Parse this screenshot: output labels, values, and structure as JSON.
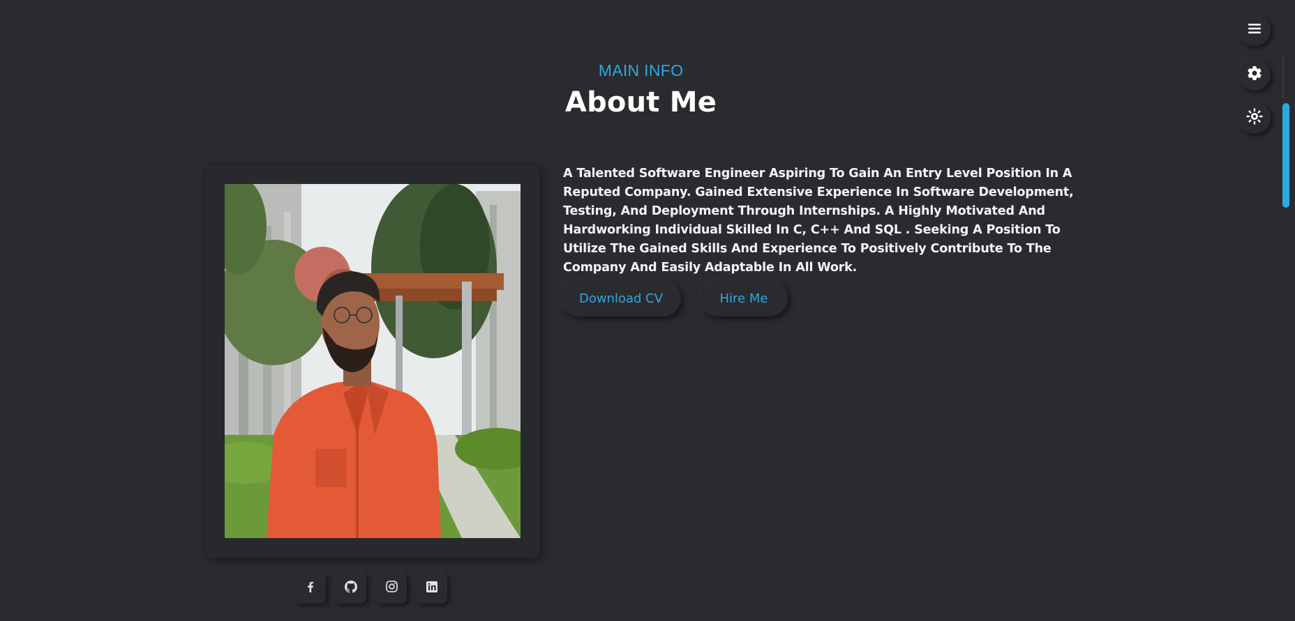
{
  "header": {
    "kicker": "MAIN INFO",
    "title": "About Me"
  },
  "profile": {
    "photo_alt": "Portrait of a man in an orange shirt standing outdoors"
  },
  "bio": {
    "text": "A Talented Software Engineer Aspiring To Gain An Entry Level Position In A Reputed Company. Gained Extensive Experience In Software Development, Testing, And Deployment Through Internships. A Highly Motivated And Hardworking Individual Skilled In C, C++ And SQL . Seeking A Position To Utilize The Gained Skills And Experience To Positively Contribute To The Company And Easily Adaptable In All Work."
  },
  "actions": {
    "download_cv": "Download CV",
    "hire_me": "Hire Me"
  },
  "social": [
    {
      "icon": "facebook-icon"
    },
    {
      "icon": "github-icon"
    },
    {
      "icon": "instagram-icon"
    },
    {
      "icon": "linkedin-icon"
    }
  ],
  "floating_controls": [
    {
      "icon": "menu-icon"
    },
    {
      "icon": "gear-icon"
    },
    {
      "icon": "sun-icon"
    }
  ],
  "colors": {
    "background": "#2a2b2f",
    "accent": "#2ea8e0",
    "text": "#ffffff"
  }
}
